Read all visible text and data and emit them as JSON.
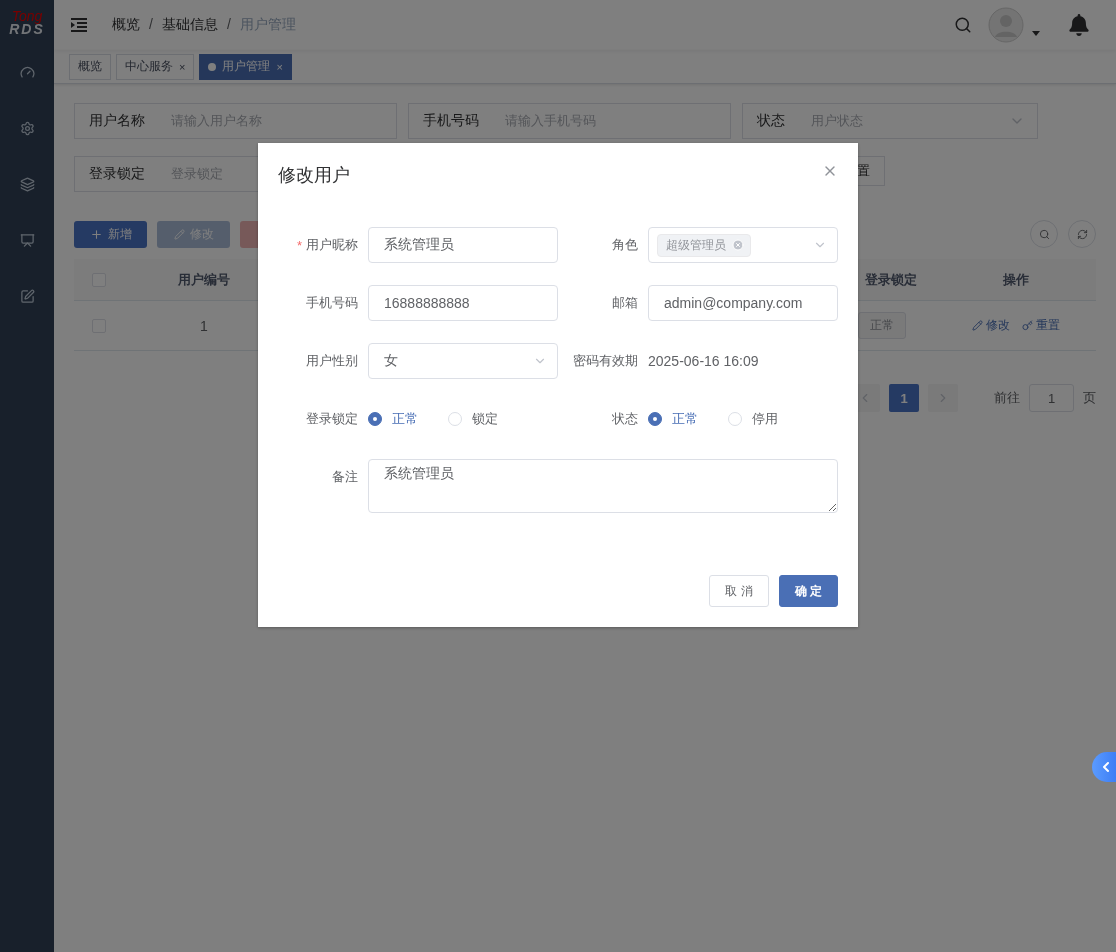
{
  "sidebar": {
    "logo": {
      "top": "Tong",
      "bottom": "RDS"
    }
  },
  "header": {
    "breadcrumb": {
      "separator": "/",
      "items": [
        "概览",
        "基础信息",
        "用户管理"
      ]
    }
  },
  "tabs": [
    {
      "label": "概览",
      "selected": false
    },
    {
      "label": "中心服务",
      "selected": false,
      "close": "×"
    },
    {
      "label": "用户管理",
      "selected": true,
      "close": "×"
    }
  ],
  "search_form": {
    "rows": [
      [
        {
          "label": "用户名称",
          "placeholder": "请输入用户名称",
          "kind": "input"
        },
        {
          "label": "手机号码",
          "placeholder": "请输入手机号码",
          "kind": "input"
        },
        {
          "label": "状态",
          "placeholder": "用户状态",
          "kind": "select"
        }
      ],
      [
        {
          "label": "登录锁定",
          "placeholder": "登录锁定",
          "kind": "input"
        }
      ]
    ],
    "buttons": [
      "置"
    ]
  },
  "toolbar": {
    "buttons": [
      {
        "label": "新增",
        "kind": "primary",
        "disabled": false
      },
      {
        "label": "修改",
        "kind": "success",
        "disabled": true
      },
      {
        "kind": "danger",
        "disabled": true
      }
    ]
  },
  "table": {
    "columns": [
      "用户编号",
      "登录锁定",
      "操作"
    ],
    "rows": [
      {
        "checked": false,
        "id": "1",
        "lock": "正常",
        "actions": [
          "修改",
          "重置"
        ]
      }
    ],
    "header_checked": false
  },
  "pagination": {
    "pages": [
      {
        "label": "1",
        "selected": true
      }
    ],
    "goto": "前往",
    "goto_value": "1",
    "unit": "页"
  },
  "dialog": {
    "title": "修改用户",
    "fields": [
      {
        "kind": "input",
        "label": "用户昵称",
        "required_mark": "*",
        "value": "系统管理员"
      },
      {
        "kind": "tags",
        "label": "角色",
        "tags": [
          "超级管理员"
        ]
      },
      {
        "kind": "input",
        "label": "手机号码",
        "value": "16888888888"
      },
      {
        "kind": "input",
        "label": "邮箱",
        "value": "admin@company.com"
      },
      {
        "kind": "select",
        "label": "用户性别",
        "value": "女"
      },
      {
        "kind": "text",
        "label": "密码有效期",
        "value": "2025-06-16 16:09"
      },
      {
        "kind": "radio",
        "label": "登录锁定",
        "options": [
          {
            "label": "正常",
            "selected": true
          },
          {
            "label": "锁定",
            "selected": false
          }
        ]
      },
      {
        "kind": "radio",
        "label": "状态",
        "options": [
          {
            "label": "正常",
            "selected": true
          },
          {
            "label": "停用",
            "selected": false
          }
        ]
      },
      {
        "kind": "textarea",
        "label": "备注",
        "value": "系统管理员"
      }
    ],
    "buttons": [
      {
        "label": "取 消",
        "kind": "default"
      },
      {
        "label": "确 定",
        "kind": "primary"
      }
    ]
  }
}
